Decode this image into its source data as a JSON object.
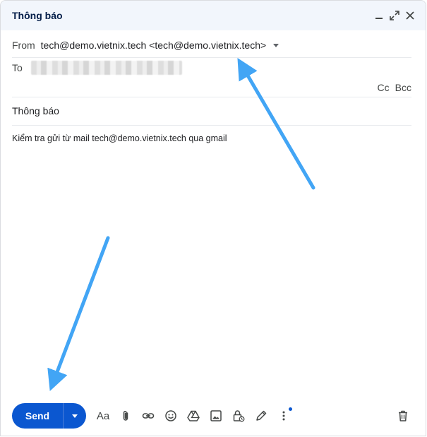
{
  "window": {
    "title": "Thông báo",
    "controls": [
      "minimize-icon",
      "expand-icon",
      "close-icon"
    ]
  },
  "from": {
    "label": "From",
    "value": "tech@demo.vietnix.tech <tech@demo.vietnix.tech>"
  },
  "to": {
    "label": "To"
  },
  "cc_label": "Cc",
  "bcc_label": "Bcc",
  "subject": "Thông báo",
  "body": "Kiểm tra gửi từ mail tech@demo.vietnix.tech qua gmail",
  "toolbar": {
    "send_label": "Send",
    "format_label": "Aa"
  },
  "colors": {
    "accent": "#0b57d0",
    "title_bar": "#f2f6fc",
    "annotation_arrow": "#42a5f5"
  }
}
